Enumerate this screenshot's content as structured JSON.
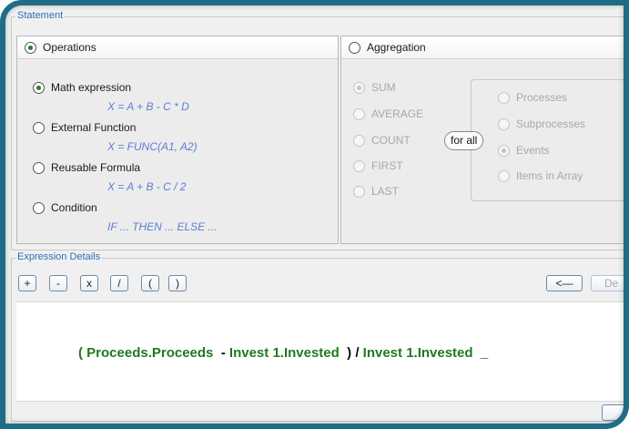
{
  "statement": {
    "title": "Statement",
    "operations": {
      "header": "Operations",
      "options": [
        {
          "label": "Math expression",
          "formula": "X = A + B - C * D",
          "selected": true
        },
        {
          "label": "External Function",
          "formula": "X = FUNC(A1, A2)",
          "selected": false
        },
        {
          "label": "Reusable Formula",
          "formula": "X = A + B - C / 2",
          "selected": false
        },
        {
          "label": "Condition",
          "formula": "IF ... THEN ... ELSE ...",
          "selected": false
        }
      ]
    },
    "aggregation": {
      "header": "Aggregation",
      "functions": [
        "SUM",
        "AVERAGE",
        "COUNT",
        "FIRST",
        "LAST"
      ],
      "for_all_label": "for all",
      "targets": [
        "Processes",
        "Subprocesses",
        "Events",
        "Items in Array"
      ],
      "selected_target": "Events"
    }
  },
  "expression_details": {
    "title": "Expression Details",
    "operator_buttons": [
      "+",
      "-",
      "x",
      "/",
      "(",
      ")"
    ],
    "backspace_label": "<—",
    "delete_label": "De",
    "expression": {
      "part1": "( Proceeds.Proceeds",
      "op1": "-",
      "part2": "Invest 1.Invested",
      "op2": ") /",
      "part3": "Invest 1.Invested",
      "cursor": "_"
    }
  },
  "colors": {
    "frame": "#1f6d86",
    "group_title": "#2e6ebc",
    "formula": "#5a7fd6",
    "expression": "#1f7a1f"
  }
}
